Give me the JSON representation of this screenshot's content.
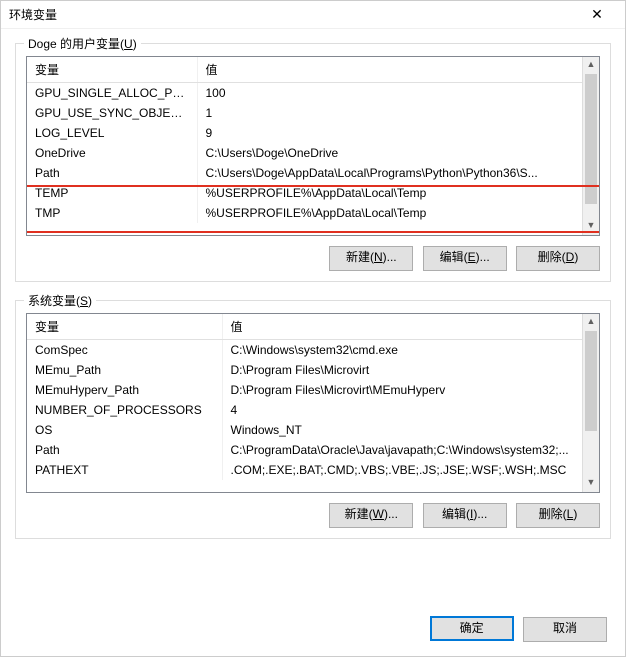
{
  "title": "环境变量",
  "user_group_label": "Doge 的用户变量(U)",
  "system_group_label": "系统变量(S)",
  "col_var": "变量",
  "col_val": "值",
  "user_vars": [
    {
      "name": "GPU_SINGLE_ALLOC_PERC...",
      "value": "100"
    },
    {
      "name": "GPU_USE_SYNC_OBJECTS",
      "value": "1"
    },
    {
      "name": "LOG_LEVEL",
      "value": "9"
    },
    {
      "name": "OneDrive",
      "value": "C:\\Users\\Doge\\OneDrive"
    },
    {
      "name": "Path",
      "value": "C:\\Users\\Doge\\AppData\\Local\\Programs\\Python\\Python36\\S..."
    },
    {
      "name": "TEMP",
      "value": "%USERPROFILE%\\AppData\\Local\\Temp"
    },
    {
      "name": "TMP",
      "value": "%USERPROFILE%\\AppData\\Local\\Temp"
    }
  ],
  "system_vars": [
    {
      "name": "ComSpec",
      "value": "C:\\Windows\\system32\\cmd.exe"
    },
    {
      "name": "MEmu_Path",
      "value": "D:\\Program Files\\Microvirt"
    },
    {
      "name": "MEmuHyperv_Path",
      "value": "D:\\Program Files\\Microvirt\\MEmuHyperv"
    },
    {
      "name": "NUMBER_OF_PROCESSORS",
      "value": "4"
    },
    {
      "name": "OS",
      "value": "Windows_NT"
    },
    {
      "name": "Path",
      "value": "C:\\ProgramData\\Oracle\\Java\\javapath;C:\\Windows\\system32;..."
    },
    {
      "name": "PATHEXT",
      "value": ".COM;.EXE;.BAT;.CMD;.VBS;.VBE;.JS;.JSE;.WSF;.WSH;.MSC"
    }
  ],
  "buttons": {
    "new_n": "新建(N)...",
    "edit_e": "编辑(E)...",
    "delete_d": "删除(D)",
    "new_w": "新建(W)...",
    "edit_i": "编辑(I)...",
    "delete_l": "删除(L)",
    "ok": "确定",
    "cancel": "取消"
  }
}
